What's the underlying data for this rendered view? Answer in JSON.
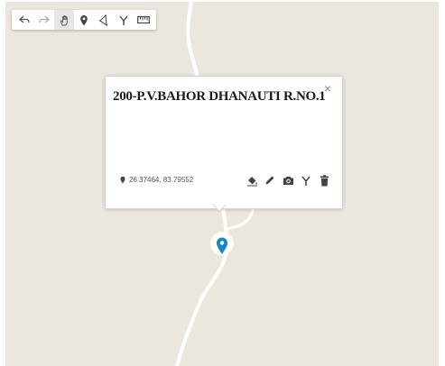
{
  "colors": {
    "map_background": "#ebe7df",
    "road": "#ffffff",
    "marker_blue": "#1586c7",
    "icon_dark": "#444444"
  },
  "toolbar": {
    "tools": [
      {
        "icon": "undo-icon"
      },
      {
        "icon": "redo-icon"
      },
      {
        "icon": "hand-pan-icon",
        "active": true
      },
      {
        "icon": "marker-pin-icon"
      },
      {
        "icon": "polygon-icon"
      },
      {
        "icon": "branch-icon"
      },
      {
        "icon": "ruler-icon"
      }
    ]
  },
  "popup": {
    "title": "200-P.V.BAHOR DHANAUTI R.NO.1",
    "close_symbol": "×",
    "coordinates": "26.37464, 83.79552",
    "actions": [
      {
        "icon": "paint-bucket-icon"
      },
      {
        "icon": "pencil-icon"
      },
      {
        "icon": "camera-icon"
      },
      {
        "icon": "branch-icon"
      },
      {
        "icon": "trash-icon"
      }
    ]
  }
}
